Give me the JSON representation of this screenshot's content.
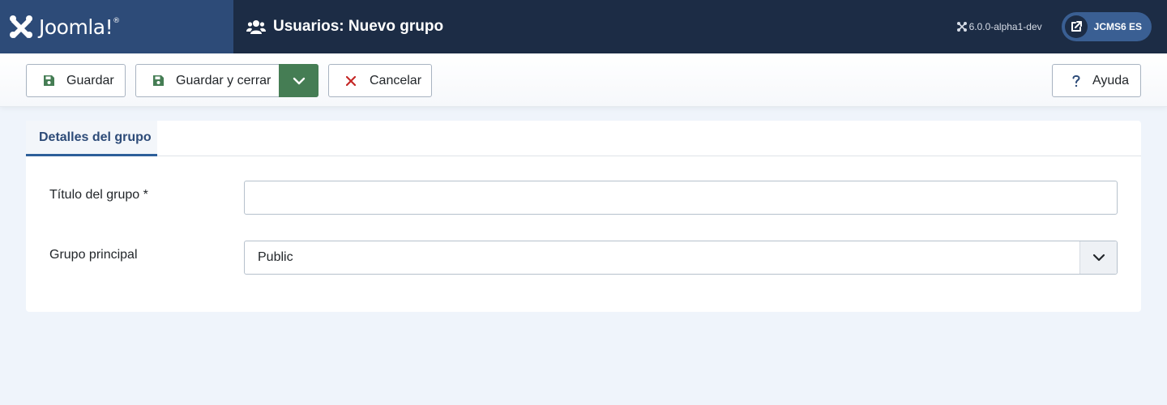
{
  "header": {
    "logo_text": "Joomla!",
    "page_title": "Usuarios: Nuevo grupo",
    "version": "6.0.0-alpha1-dev",
    "site_label": "JCMS6 ES"
  },
  "toolbar": {
    "save_label": "Guardar",
    "save_close_label": "Guardar y cerrar",
    "cancel_label": "Cancelar",
    "help_label": "Ayuda"
  },
  "tabs": [
    {
      "label": "Detalles del grupo",
      "active": true
    }
  ],
  "form": {
    "title_label": "Título del grupo *",
    "title_value": "",
    "parent_label": "Grupo principal",
    "parent_value": "Public"
  },
  "colors": {
    "header_bg": "#1c2c45",
    "logo_bg": "#2d4b78",
    "save_green": "#457d54",
    "cancel_red": "#c52827",
    "tab_accent": "#2d5f9a",
    "page_bg": "#eff4fb"
  },
  "icons": {
    "logo": "joomla-logo-icon",
    "title": "users-icon",
    "version": "joomla-small-icon",
    "site": "external-link-icon",
    "save": "floppy-disk-icon",
    "dropdown": "chevron-down-icon",
    "cancel": "close-icon",
    "help": "question-icon"
  }
}
